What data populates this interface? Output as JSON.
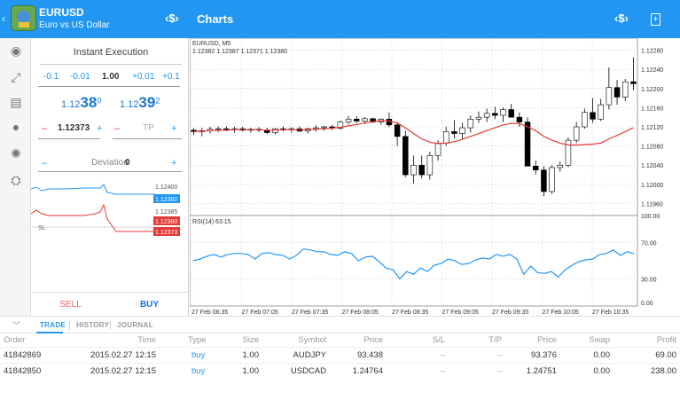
{
  "header": {
    "symbol": "EURUSD",
    "description": "Euro vs US Dollar",
    "charts_title": "Charts",
    "dollar_icon": "‹$›"
  },
  "order_panel": {
    "mode": "Instant Execution",
    "volume_buttons": [
      "-0.1",
      "-0.01",
      "1.00",
      "+0.01",
      "+0.1"
    ],
    "sell_price": {
      "prefix": "1.12",
      "big": "38",
      "sup": "0"
    },
    "buy_price": {
      "prefix": "1.12",
      "big": "39",
      "sup": "2"
    },
    "sl_value": "1.12373",
    "tp_placeholder": "TP",
    "deviation_label": "Deviation",
    "deviation_value": "0",
    "mini_chart_labels": {
      "level1": "1.12400",
      "buy": "1.12392",
      "level2": "1.12385",
      "sell": "1.12380",
      "sl_price": "1.12373",
      "sl": "SL"
    },
    "sell_button": "SELL",
    "buy_button": "BUY"
  },
  "chart": {
    "symbol_tf": "EURUSD, M5",
    "ohlc": "1.12382 1.12387 1.12371 1.12380",
    "rsi_label": "RSI(14) 63.15",
    "price_ticks": [
      "1.12280",
      "1.12240",
      "1.12200",
      "1.12160",
      "1.12120",
      "1.12080",
      "1.12040",
      "1.12000",
      "1.11960"
    ],
    "rsi_ticks": [
      "100.00",
      "70.00",
      "30.00",
      "0.00"
    ],
    "time_ticks": [
      "27 Feb 06:35",
      "27 Feb 07:05",
      "27 Feb 07:35",
      "27 Feb 08:05",
      "27 Feb 08:35",
      "27 Feb 09:05",
      "27 Feb 09:35",
      "27 Feb 10:05",
      "27 Feb 10:35"
    ],
    "colors": {
      "ma": "#e53935",
      "rsi": "#2196f3",
      "bull": "#ffffff",
      "bear": "#000000"
    }
  },
  "chart_data": {
    "type": "candlestick",
    "price_range": [
      1.11935,
      1.12305
    ],
    "rsi_range": [
      0,
      100
    ],
    "candles": [
      [
        1.12113,
        1.12117,
        1.12103,
        1.1211
      ],
      [
        1.1211,
        1.12118,
        1.121,
        1.12112
      ],
      [
        1.12112,
        1.1212,
        1.12106,
        1.12115
      ],
      [
        1.12115,
        1.12121,
        1.12109,
        1.12116
      ],
      [
        1.12116,
        1.12121,
        1.12111,
        1.12114
      ],
      [
        1.12114,
        1.1212,
        1.12108,
        1.12116
      ],
      [
        1.12116,
        1.1212,
        1.1211,
        1.12113
      ],
      [
        1.12113,
        1.12118,
        1.12108,
        1.12115
      ],
      [
        1.12115,
        1.12119,
        1.12109,
        1.12113
      ],
      [
        1.12113,
        1.12118,
        1.12105,
        1.12108
      ],
      [
        1.12108,
        1.12118,
        1.12104,
        1.12116
      ],
      [
        1.12116,
        1.12121,
        1.1211,
        1.12114
      ],
      [
        1.12114,
        1.12119,
        1.12108,
        1.12116
      ],
      [
        1.12116,
        1.12121,
        1.1211,
        1.12111
      ],
      [
        1.12111,
        1.12118,
        1.12106,
        1.12116
      ],
      [
        1.12116,
        1.12123,
        1.1211,
        1.12118
      ],
      [
        1.12118,
        1.12122,
        1.12112,
        1.1212
      ],
      [
        1.1212,
        1.12124,
        1.12113,
        1.12117
      ],
      [
        1.12117,
        1.12133,
        1.12114,
        1.1213
      ],
      [
        1.1213,
        1.12143,
        1.12125,
        1.12136
      ],
      [
        1.12136,
        1.12142,
        1.12128,
        1.12132
      ],
      [
        1.12132,
        1.1214,
        1.12126,
        1.12137
      ],
      [
        1.12137,
        1.12139,
        1.12128,
        1.1213
      ],
      [
        1.1213,
        1.12138,
        1.12124,
        1.12136
      ],
      [
        1.12136,
        1.1215,
        1.1212,
        1.12124
      ],
      [
        1.12124,
        1.1213,
        1.1208,
        1.121
      ],
      [
        1.121,
        1.12112,
        1.12015,
        1.1202
      ],
      [
        1.1202,
        1.1206,
        1.12002,
        1.1204
      ],
      [
        1.1204,
        1.1206,
        1.12012,
        1.1202
      ],
      [
        1.1202,
        1.12068,
        1.1201,
        1.1206
      ],
      [
        1.1206,
        1.12092,
        1.1205,
        1.12086
      ],
      [
        1.12086,
        1.1212,
        1.1208,
        1.1211
      ],
      [
        1.1211,
        1.12134,
        1.12096,
        1.12106
      ],
      [
        1.12106,
        1.12128,
        1.12094,
        1.12118
      ],
      [
        1.12118,
        1.12144,
        1.12108,
        1.12136
      ],
      [
        1.12136,
        1.12152,
        1.12128,
        1.1214
      ],
      [
        1.1214,
        1.12158,
        1.1213,
        1.12148
      ],
      [
        1.12148,
        1.12162,
        1.12136,
        1.12144
      ],
      [
        1.12144,
        1.1216,
        1.1213,
        1.12156
      ],
      [
        1.12156,
        1.12168,
        1.12146,
        1.1214
      ],
      [
        1.1214,
        1.1215,
        1.1212,
        1.1213
      ],
      [
        1.1213,
        1.1214,
        1.1204,
        1.12038
      ],
      [
        1.12038,
        1.1205,
        1.1202,
        1.1203
      ],
      [
        1.1203,
        1.12038,
        1.11975,
        1.11985
      ],
      [
        1.11985,
        1.1204,
        1.1198,
        1.12035
      ],
      [
        1.12035,
        1.12048,
        1.12026,
        1.1204
      ],
      [
        1.1204,
        1.12098,
        1.12036,
        1.12092
      ],
      [
        1.12092,
        1.1213,
        1.12086,
        1.1212
      ],
      [
        1.1212,
        1.12158,
        1.12116,
        1.1215
      ],
      [
        1.1215,
        1.1218,
        1.12128,
        1.12136
      ],
      [
        1.12136,
        1.12178,
        1.12132,
        1.12166
      ],
      [
        1.12166,
        1.12244,
        1.12156,
        1.12202
      ],
      [
        1.12202,
        1.12218,
        1.12166,
        1.12182
      ],
      [
        1.12182,
        1.1222,
        1.12174,
        1.12214
      ],
      [
        1.12214,
        1.12265,
        1.12196,
        1.1221
      ]
    ],
    "ma": [
      1.1211,
      1.12111,
      1.12112,
      1.12113,
      1.12113,
      1.12114,
      1.12114,
      1.12114,
      1.12114,
      1.12113,
      1.12113,
      1.12114,
      1.12114,
      1.12114,
      1.12114,
      1.12115,
      1.12116,
      1.12117,
      1.12119,
      1.12122,
      1.12125,
      1.12128,
      1.12131,
      1.12133,
      1.12132,
      1.12128,
      1.12118,
      1.12106,
      1.12095,
      1.12088,
      1.12085,
      1.12086,
      1.12089,
      1.12094,
      1.121,
      1.12106,
      1.12112,
      1.12118,
      1.12124,
      1.12127,
      1.12127,
      1.1212,
      1.12112,
      1.121,
      1.12092,
      1.12086,
      1.12082,
      1.12082,
      1.12083,
      1.12084,
      1.12086,
      1.12095,
      1.12102,
      1.1211,
      1.12118
    ],
    "rsi": [
      50,
      52,
      55,
      57,
      54,
      57,
      58,
      58,
      57,
      52,
      58,
      59,
      57,
      56,
      52,
      56,
      63,
      62,
      60,
      60,
      57,
      56,
      60,
      58,
      50,
      54,
      55,
      49,
      42,
      40,
      30,
      38,
      35,
      42,
      38,
      45,
      47,
      52,
      50,
      46,
      47,
      51,
      53,
      52,
      57,
      55,
      57,
      52,
      35,
      44,
      37,
      36,
      38,
      32,
      40,
      45,
      49,
      51,
      52,
      57,
      58,
      62,
      56,
      60,
      58
    ]
  },
  "bottom": {
    "tabs": [
      "TRADE",
      "HISTORY",
      "JOURNAL"
    ],
    "columns": [
      "Order",
      "Time",
      "Type",
      "Size",
      "Symbol",
      "Price",
      "S/L",
      "T/P",
      "Price",
      "Swap",
      "Profit"
    ],
    "rows": [
      [
        "41842869",
        "2015.02.27 12:15",
        "buy",
        "1.00",
        "AUDJPY",
        "93.438",
        "–",
        "–",
        "93.376",
        "0.00",
        "69.00"
      ],
      [
        "41842850",
        "2015.02.27 12:15",
        "buy",
        "1.00",
        "USDCAD",
        "1.24764",
        "–",
        "–",
        "1.24751",
        "0.00",
        "238.00"
      ]
    ]
  }
}
